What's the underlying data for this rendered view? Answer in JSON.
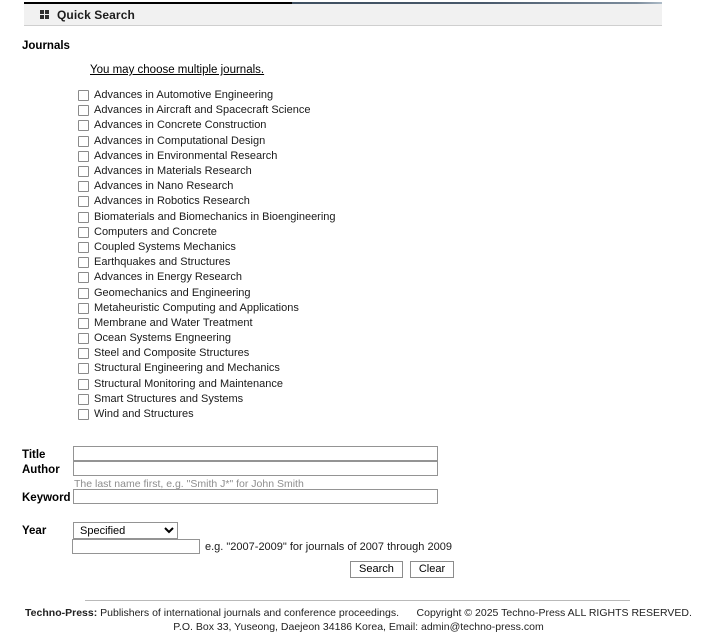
{
  "header": {
    "icon": "grid-squares-icon",
    "title": "Quick Search"
  },
  "journals": {
    "section_label": "Journals",
    "note": "You may choose multiple journals.",
    "items": [
      "Advances in Automotive Engineering",
      "Advances in Aircraft and Spacecraft Science",
      "Advances in Concrete Construction",
      "Advances in Computational Design",
      "Advances in Environmental Research",
      "Advances in Materials Research",
      "Advances in Nano Research",
      "Advances in Robotics Research",
      "Biomaterials and Biomechanics in Bioengineering",
      "Computers and Concrete",
      "Coupled Systems Mechanics",
      "Earthquakes and Structures",
      "Advances in Energy Research",
      "Geomechanics and Engineering",
      "Metaheuristic Computing and Applications",
      "Membrane and Water Treatment",
      "Ocean Systems Engneering",
      "Steel and Composite Structures",
      "Structural Engineering and Mechanics",
      "Structural Monitoring and Maintenance",
      "Smart Structures and Systems",
      "Wind and Structures"
    ]
  },
  "form": {
    "title": {
      "label": "Title",
      "value": "",
      "placeholder": ""
    },
    "author": {
      "label": "Author",
      "value": "",
      "placeholder": "",
      "hint": "The last name first, e.g. \"Smith J*\" for John Smith"
    },
    "keyword": {
      "label": "Keyword",
      "value": "",
      "placeholder": ""
    },
    "year": {
      "label": "Year",
      "selected": "Specified",
      "options": [
        "Specified"
      ],
      "value": "",
      "placeholder": "",
      "hint": "e.g. \"2007-2009\" for journals of 2007 through 2009"
    },
    "buttons": {
      "search": "Search",
      "clear": "Clear"
    }
  },
  "footer": {
    "brand": "Techno-Press:",
    "tagline": "Publishers of international journals and conference proceedings.",
    "copyright": "Copyright © 2025 Techno-Press ALL RIGHTS RESERVED.",
    "address": "P.O. Box 33, Yuseong, Daejeon 34186 Korea, Email: admin@techno-press.com"
  },
  "colors": {
    "header_bar_bg": "#f1f1f1",
    "header_accent_dark": "#000000",
    "header_accent_blue": "#3e4f60",
    "input_border": "#949494",
    "hint_gray": "#8e8e8e"
  }
}
